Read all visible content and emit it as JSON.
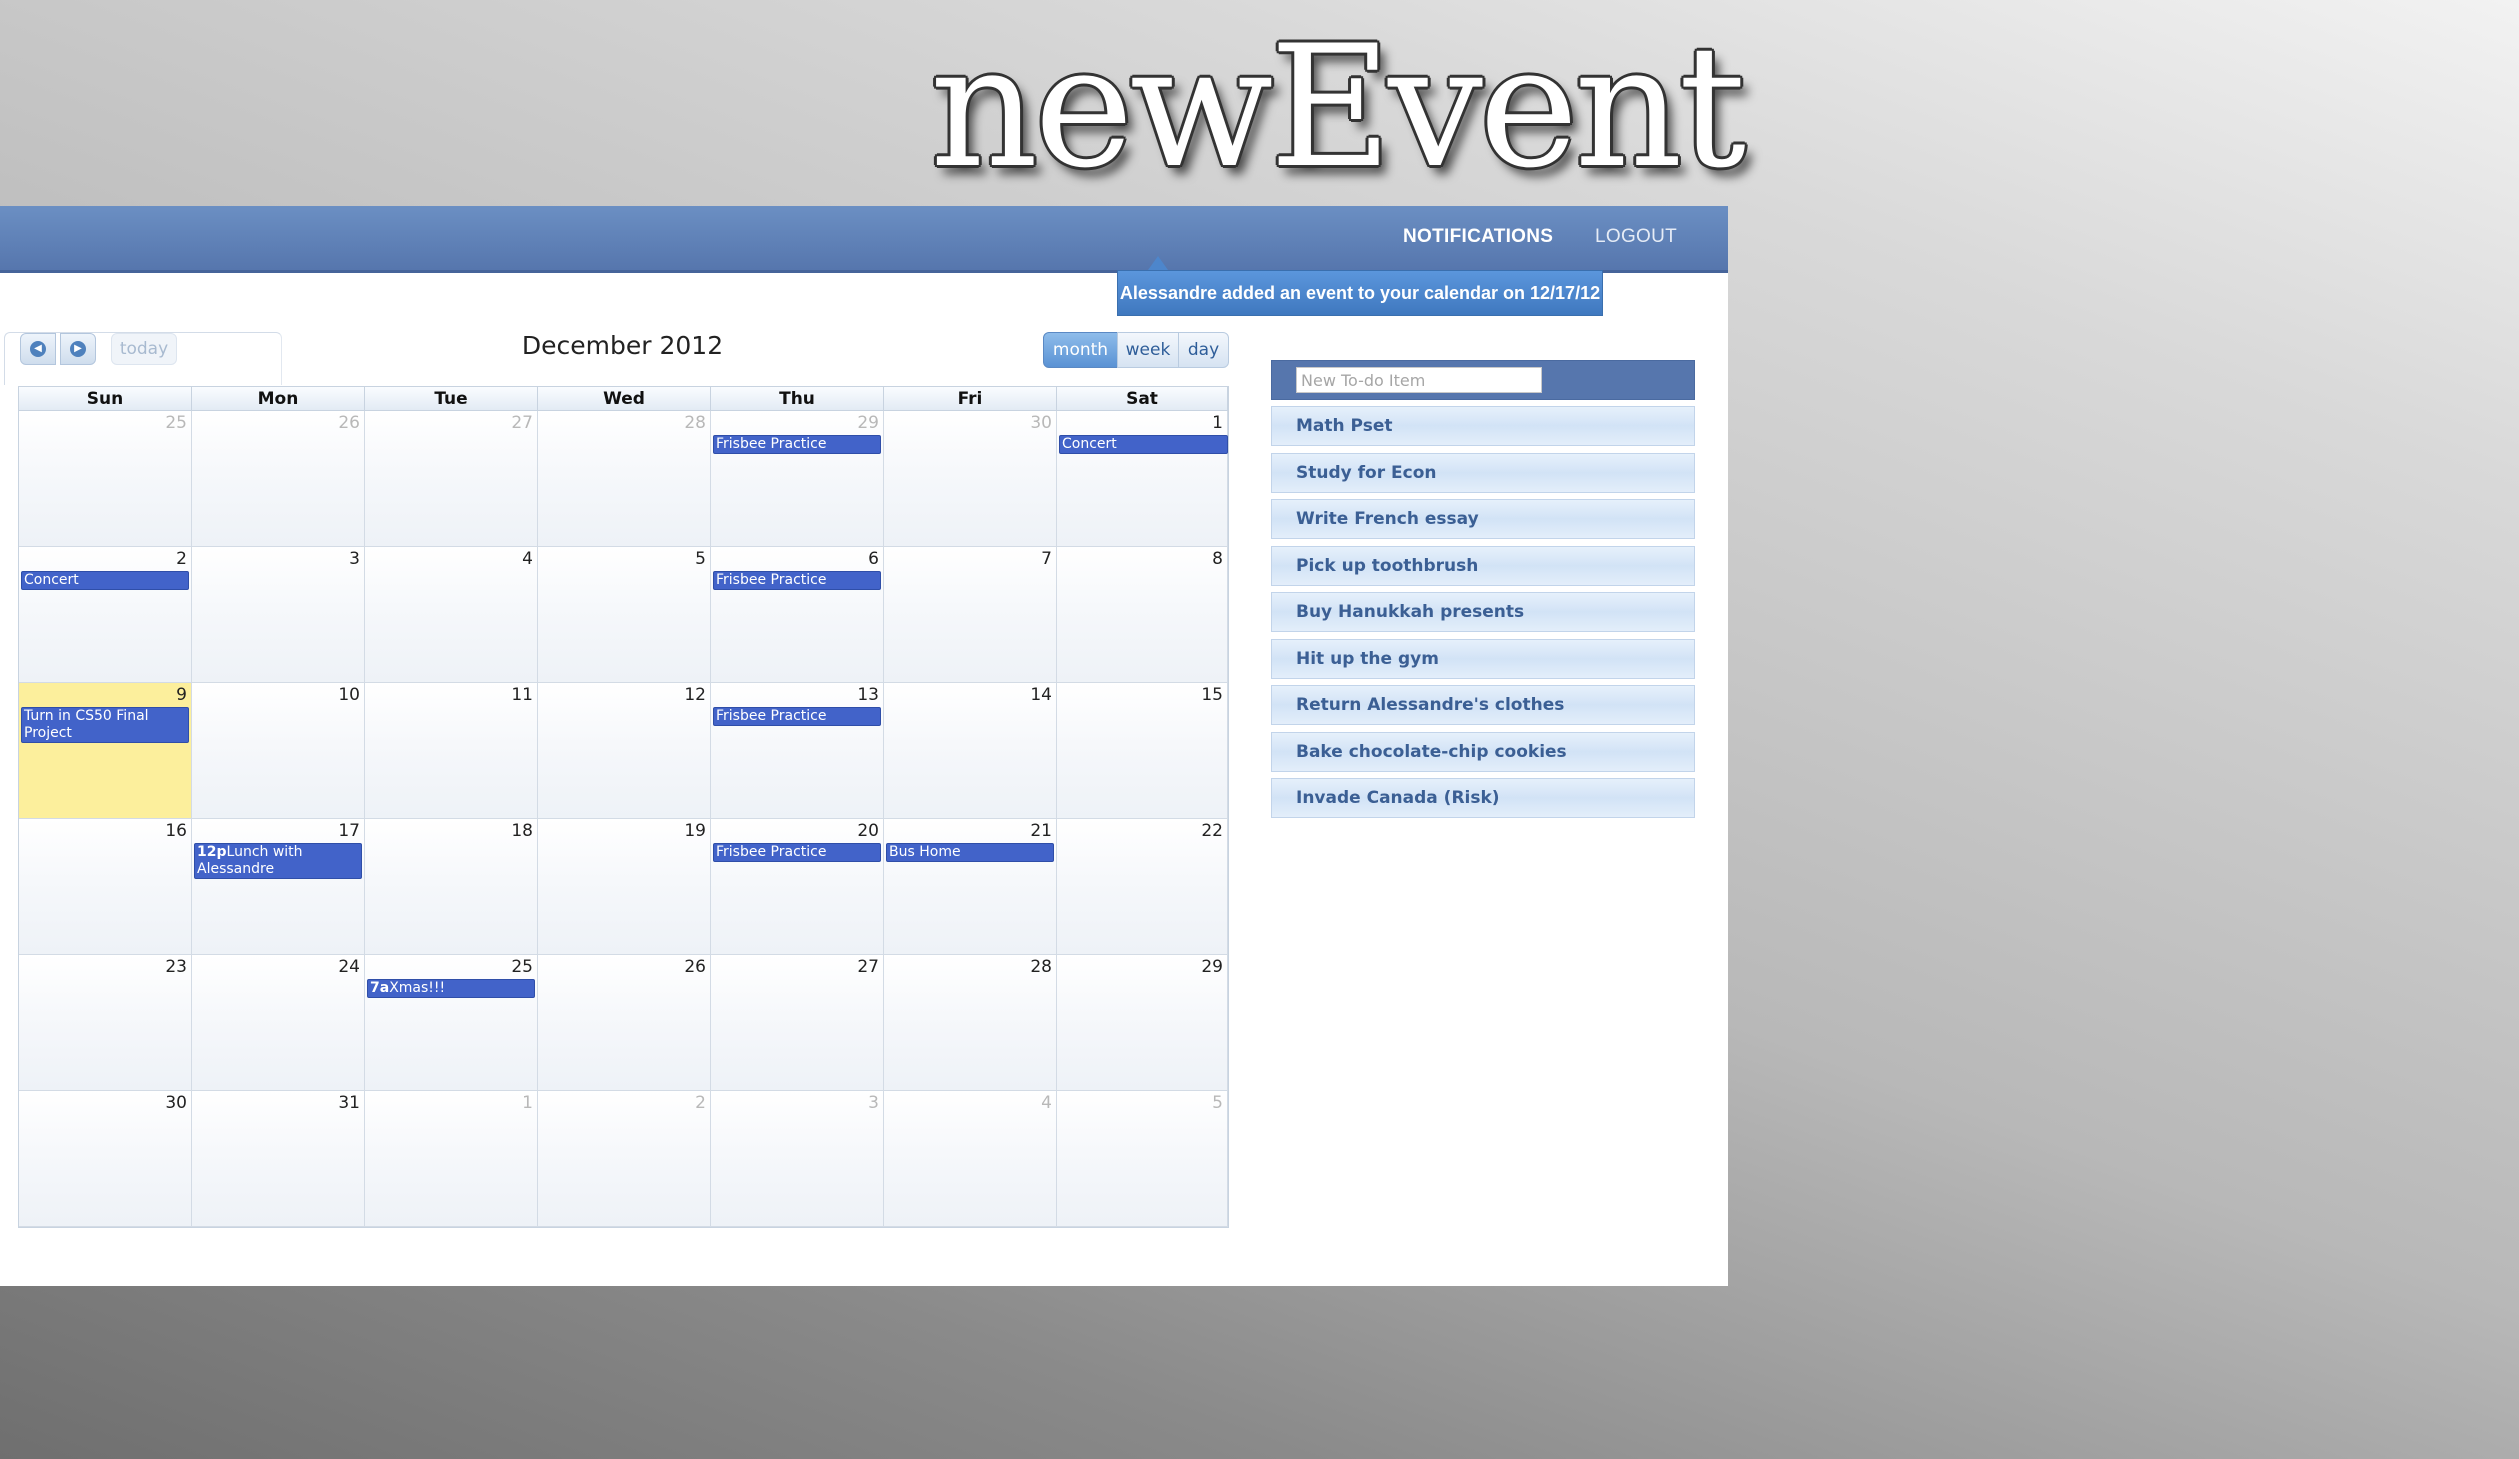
{
  "brand": {
    "logo": "newEvent"
  },
  "nav": {
    "notifications": "NOTIFICATIONS",
    "logout": "LOGOUT"
  },
  "notification": {
    "text": "Alessandre added an event to your calendar on 12/17/12"
  },
  "calendar": {
    "title": "December 2012",
    "today_label": "today",
    "views": {
      "month": "month",
      "week": "week",
      "day": "day"
    },
    "active_view": "month",
    "weekdays": [
      "Sun",
      "Mon",
      "Tue",
      "Wed",
      "Thu",
      "Fri",
      "Sat"
    ],
    "weeks": [
      [
        {
          "day": "25",
          "other": true
        },
        {
          "day": "26",
          "other": true
        },
        {
          "day": "27",
          "other": true
        },
        {
          "day": "28",
          "other": true
        },
        {
          "day": "29",
          "other": true,
          "events": [
            {
              "title": "Frisbee Practice"
            }
          ]
        },
        {
          "day": "30",
          "other": true
        },
        {
          "day": "1",
          "events": [
            {
              "title": "Concert"
            }
          ]
        }
      ],
      [
        {
          "day": "2",
          "events": [
            {
              "title": "Concert"
            }
          ]
        },
        {
          "day": "3"
        },
        {
          "day": "4"
        },
        {
          "day": "5"
        },
        {
          "day": "6",
          "events": [
            {
              "title": "Frisbee Practice"
            }
          ]
        },
        {
          "day": "7"
        },
        {
          "day": "8"
        }
      ],
      [
        {
          "day": "9",
          "today": true,
          "events": [
            {
              "title": "Turn in CS50 Final Project"
            }
          ]
        },
        {
          "day": "10"
        },
        {
          "day": "11"
        },
        {
          "day": "12"
        },
        {
          "day": "13",
          "events": [
            {
              "title": "Frisbee Practice"
            }
          ]
        },
        {
          "day": "14"
        },
        {
          "day": "15"
        }
      ],
      [
        {
          "day": "16"
        },
        {
          "day": "17",
          "events": [
            {
              "time": "12p",
              "title": "Lunch with Alessandre"
            }
          ]
        },
        {
          "day": "18"
        },
        {
          "day": "19"
        },
        {
          "day": "20",
          "events": [
            {
              "title": "Frisbee Practice"
            }
          ]
        },
        {
          "day": "21",
          "events": [
            {
              "title": "Bus Home"
            }
          ]
        },
        {
          "day": "22"
        }
      ],
      [
        {
          "day": "23"
        },
        {
          "day": "24"
        },
        {
          "day": "25",
          "events": [
            {
              "time": "7a",
              "title": "Xmas!!!"
            }
          ]
        },
        {
          "day": "26"
        },
        {
          "day": "27"
        },
        {
          "day": "28"
        },
        {
          "day": "29"
        }
      ],
      [
        {
          "day": "30"
        },
        {
          "day": "31"
        },
        {
          "day": "1",
          "other": true
        },
        {
          "day": "2",
          "other": true
        },
        {
          "day": "3",
          "other": true
        },
        {
          "day": "4",
          "other": true
        },
        {
          "day": "5",
          "other": true
        }
      ]
    ]
  },
  "todo": {
    "placeholder": "New To-do Item",
    "items": [
      "Math Pset",
      "Study for Econ",
      "Write French essay",
      "Pick up toothbrush",
      "Buy Hanukkah presents",
      "Hit up the gym",
      "Return Alessandre's clothes",
      "Bake chocolate-chip cookies",
      "Invade Canada (Risk)"
    ]
  },
  "colors": {
    "nav_bar": "#5676ad",
    "event": "#4263c9",
    "today_cell": "#fcef9c",
    "notification": "#4a86cf"
  }
}
